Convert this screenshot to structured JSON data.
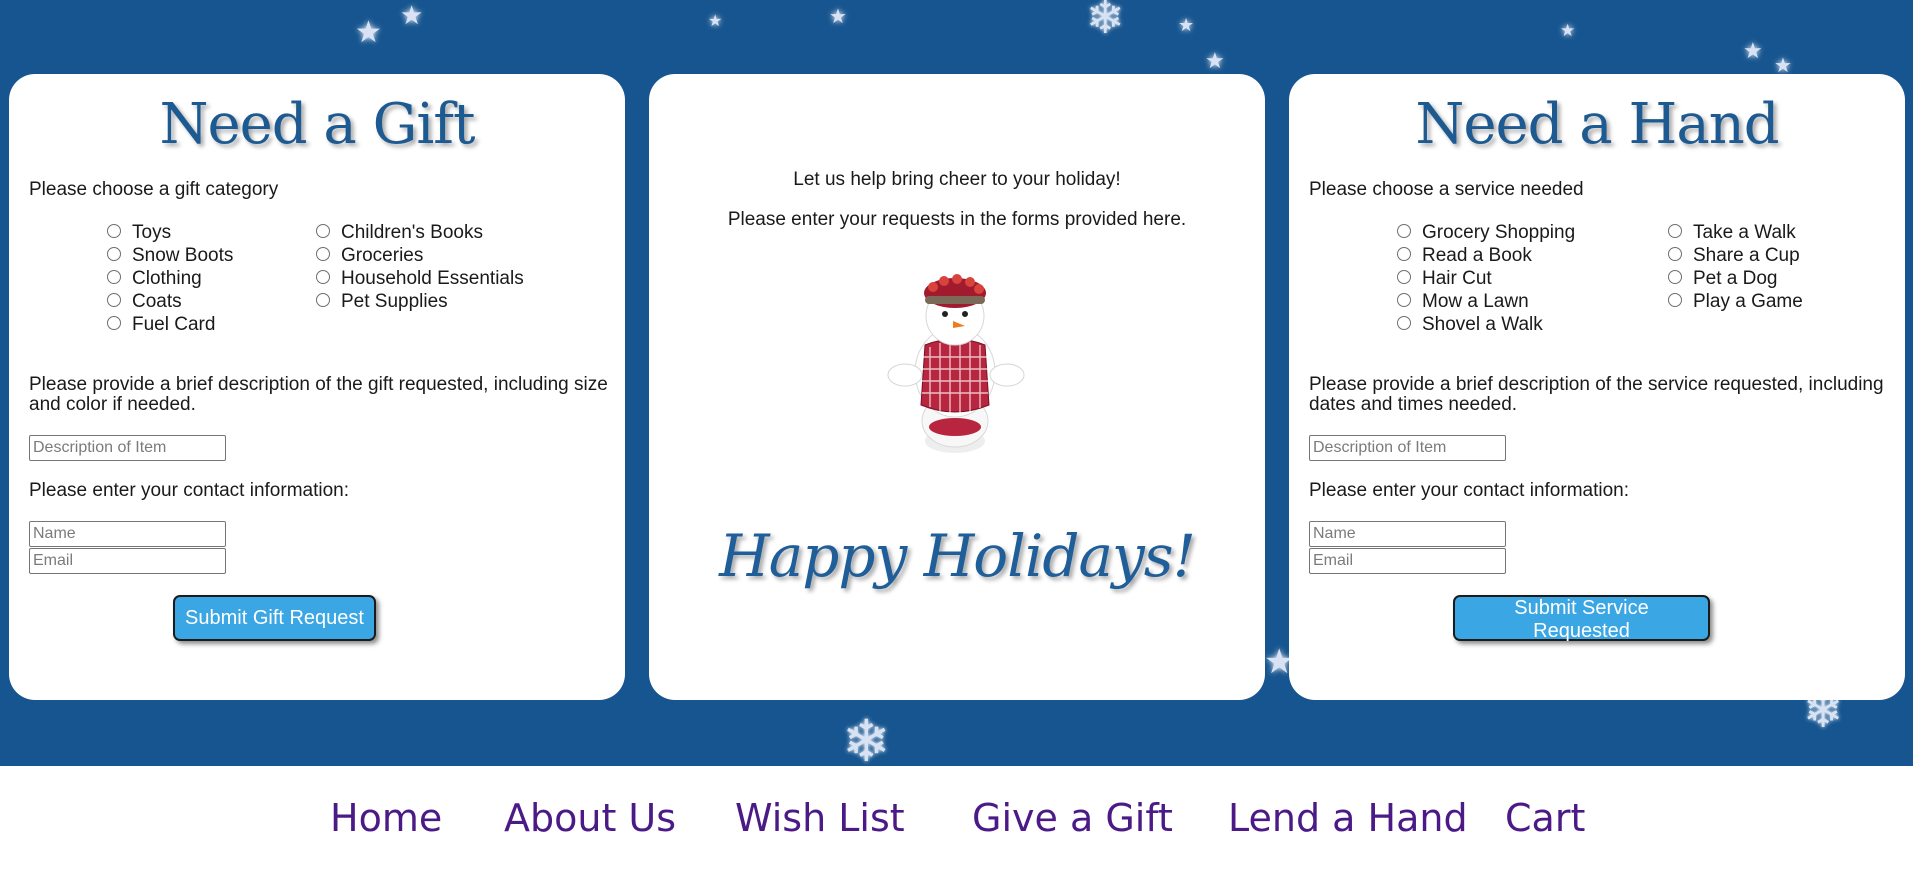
{
  "gift": {
    "title": "Need a Gift",
    "category_prompt": "Please choose a gift category",
    "categories_col1": [
      "Toys",
      "Snow Boots",
      "Clothing",
      "Coats",
      "Fuel Card"
    ],
    "categories_col2": [
      "Children's Books",
      "Groceries",
      "Household Essentials",
      "Pet Supplies"
    ],
    "description_prompt": "Please provide a brief description of the gift requested, including size and color if needed.",
    "description_placeholder": "Description of Item",
    "contact_prompt": "Please enter your contact information:",
    "name_placeholder": "Name",
    "email_placeholder": "Email",
    "submit_label": "Submit Gift Request"
  },
  "center": {
    "line1": "Let us help bring cheer to your holiday!",
    "line2": "Please enter your requests in the forms provided here.",
    "greeting": "Happy Holidays!"
  },
  "hand": {
    "title": "Need a Hand",
    "service_prompt": "Please choose a service needed",
    "services_col1": [
      "Grocery Shopping",
      "Read a Book",
      "Hair Cut",
      "Mow a Lawn",
      "Shovel a Walk"
    ],
    "services_col2": [
      "Take a Walk",
      "Share a Cup",
      "Pet a Dog",
      "Play a Game"
    ],
    "description_prompt": "Please provide a brief description of the service requested, including dates and times needed.",
    "description_placeholder": "Description of Item",
    "contact_prompt": "Please enter your contact information:",
    "name_placeholder": "Name",
    "email_placeholder": "Email",
    "submit_label": "Submit Service Requested"
  },
  "nav": {
    "items": [
      "Home",
      "About Us",
      "Wish List",
      "Give a Gift",
      "Lend a Hand",
      "Cart"
    ]
  },
  "colors": {
    "background": "#175590",
    "title": "#1e5a92",
    "button": "#3aa6e3",
    "nav_text": "#4b1a86"
  }
}
